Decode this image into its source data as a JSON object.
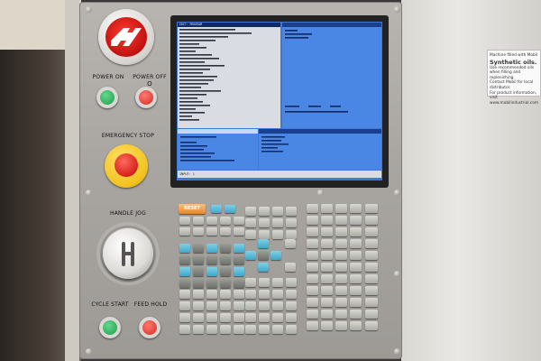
{
  "panel": {
    "power_on_label": "POWER ON",
    "power_off_label": "POWER OFF",
    "power_off_symbol": "O",
    "emergency_stop_label": "EMERGENCY STOP",
    "handle_jog_label": "HANDLE JOG",
    "cycle_start_label": "CYCLE START",
    "feed_hold_label": "FEED HOLD",
    "reset_key_label": "RESET"
  },
  "sticker": {
    "line1": "Machine filled with Mobil",
    "line2": "Synthetic oils.",
    "line3": "Use recommended oils",
    "line4": "when filling and replenishing.",
    "line5": "Contact Mobil for local distributor.",
    "line6": "For product information, visit",
    "line7": "www.mobilindustrial.com"
  },
  "screen": {
    "left_title": "EDIT: PROGRAM",
    "right_title": "",
    "input_label": "INPUT: 1"
  },
  "colors": {
    "screen_blue": "#3f79d6",
    "estop_red": "#d6221c",
    "estop_yellow": "#f2c21b",
    "power_on_green": "#1f9a48",
    "power_off_red": "#d32b24",
    "logo_red": "#d21812"
  }
}
